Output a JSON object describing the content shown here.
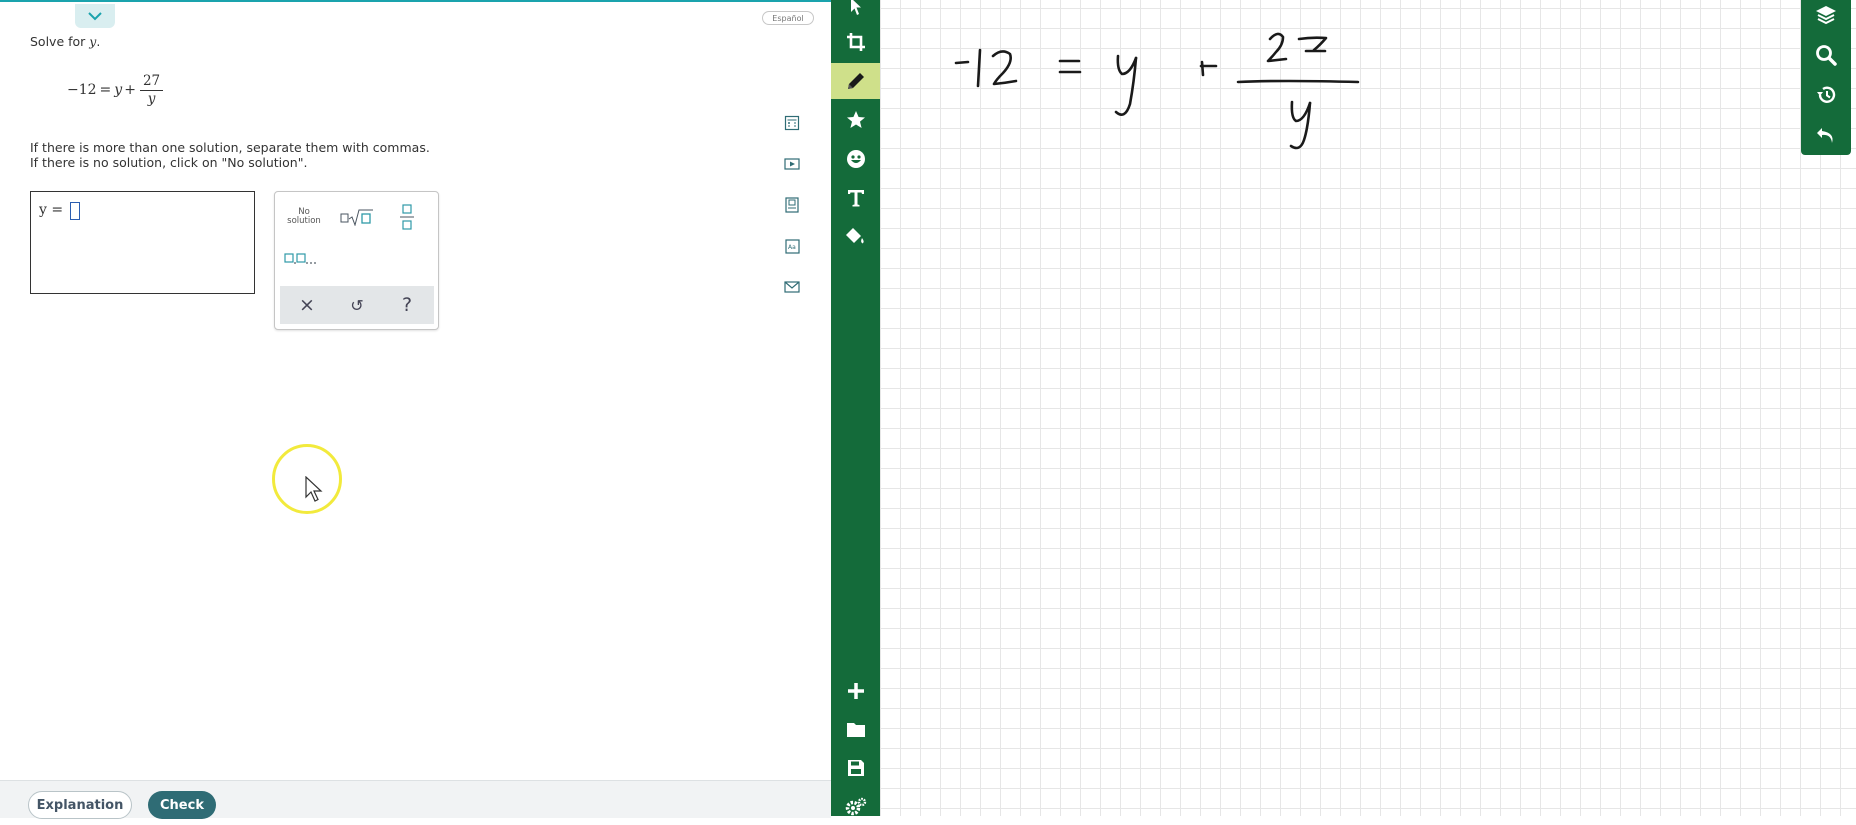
{
  "problem": {
    "prompt_prefix": "Solve for ",
    "prompt_var": "y",
    "prompt_suffix": ".",
    "equation": {
      "lhs": "−12",
      "equals": "=",
      "rhs_var": "y",
      "plus": "+",
      "frac_numerator": "27",
      "frac_denominator": "y"
    },
    "instruction_1": "If there is more than one solution, separate them with commas.",
    "instruction_2": "If there is no solution, click on \"No solution\"."
  },
  "language_button": "Español",
  "answer": {
    "label": "y  =",
    "value": ""
  },
  "palette": {
    "no_solution_line1": "No",
    "no_solution_line2": "solution",
    "list_label": "□,□,...",
    "clear_symbol": "×",
    "undo_symbol": "↺",
    "help_symbol": "?"
  },
  "side_icons": [
    "calculator-icon",
    "video-icon",
    "ebook-icon",
    "glossary-icon",
    "mail-icon"
  ],
  "footer": {
    "explanation_label": "Explanation",
    "check_label": "Check"
  },
  "whiteboard": {
    "left_tools": [
      "pointer-icon",
      "crop-icon",
      "pen-icon",
      "star-icon",
      "sticker-icon",
      "text-icon",
      "fill-icon",
      "add-icon",
      "folder-icon",
      "save-icon",
      "settings-icon"
    ],
    "active_tool": "pen-icon",
    "right_tools": [
      "layers-icon",
      "zoom-icon",
      "history-icon",
      "undo-icon"
    ],
    "colors": {
      "toolbar": "#146b3a",
      "active_tool_bg": "#cfe08a",
      "grid": "#e6e6e6"
    }
  },
  "colors": {
    "accent": "#2f9aa8",
    "check_button": "#2f6c75",
    "cursor_highlight": "#f2ea3c"
  }
}
